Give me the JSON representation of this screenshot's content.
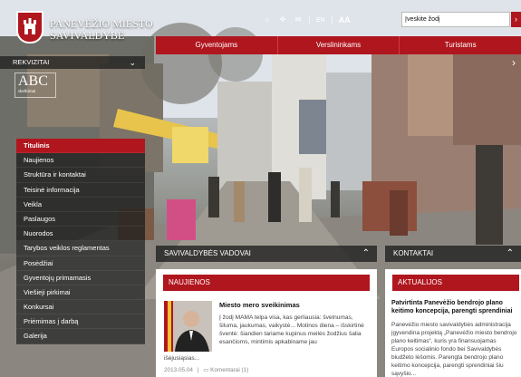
{
  "header": {
    "title_line1": "PANEVĖŽIO MIESTO",
    "title_line2": "SAVIVALDYBĖ",
    "tools": {
      "lang": "EN",
      "font_size": "AA"
    },
    "search_value": "Įveskite žodį",
    "search_button": "›"
  },
  "topnav": [
    "Gyventojams",
    "Verslininkams",
    "Turistams"
  ],
  "rekvizitai": "REKVIZITAI",
  "abc_logo": {
    "big": "ABC",
    "small": "skelbimai"
  },
  "left_menu": [
    "Titulinis",
    "Naujienos",
    "Struktūra ir kontaktai",
    "Teisinė informacija",
    "Veikla",
    "Paslaugos",
    "Nuorodos",
    "Tarybos veiklos reglamentas",
    "Posėdžiai",
    "Gyventojų primamasis",
    "Viešieji pirkimai",
    "Konkursai",
    "Priėmimas į darbą",
    "Galerija"
  ],
  "sections": {
    "vadovai": "SAVIVALDYBĖS VADOVAI",
    "kontaktai": "KONTAKTAI"
  },
  "news": {
    "header": "NAUJIENOS",
    "title": "Miesto mero sveikinimas",
    "text": "Į žodį MAMA telpa visa, kas gerliausia: švelnumas, šiluma, jaukumas, vaikystė... Motinos diena – išskirtinė šventė: šiandien tariame kupinus meilės žodžius šalia esančioms, mintimis apkabiname jau",
    "text2": "išėjusiąsias...",
    "date": "2013.05.04",
    "comments": "Komentarai (1)"
  },
  "actual": {
    "header": "AKTUALIJOS",
    "title": "Patvirtinta Panevėžio bendrojo plano keitimo koncepcija, parengti sprendiniai",
    "text": "Panevėžio miesto savivaldybės administracija įgyvendina projektą „Panevėžio miesto bendrojo plano keitimas“, kuris yra finansuojamas Europos socialinio fondo bei Savivaldybės biudžeto lėšomis. Parengta bendrojo plano keitimo koncepcija, parengti sprendiniai šiu sąvyšio..."
  },
  "colors": {
    "accent": "#b0161e"
  }
}
